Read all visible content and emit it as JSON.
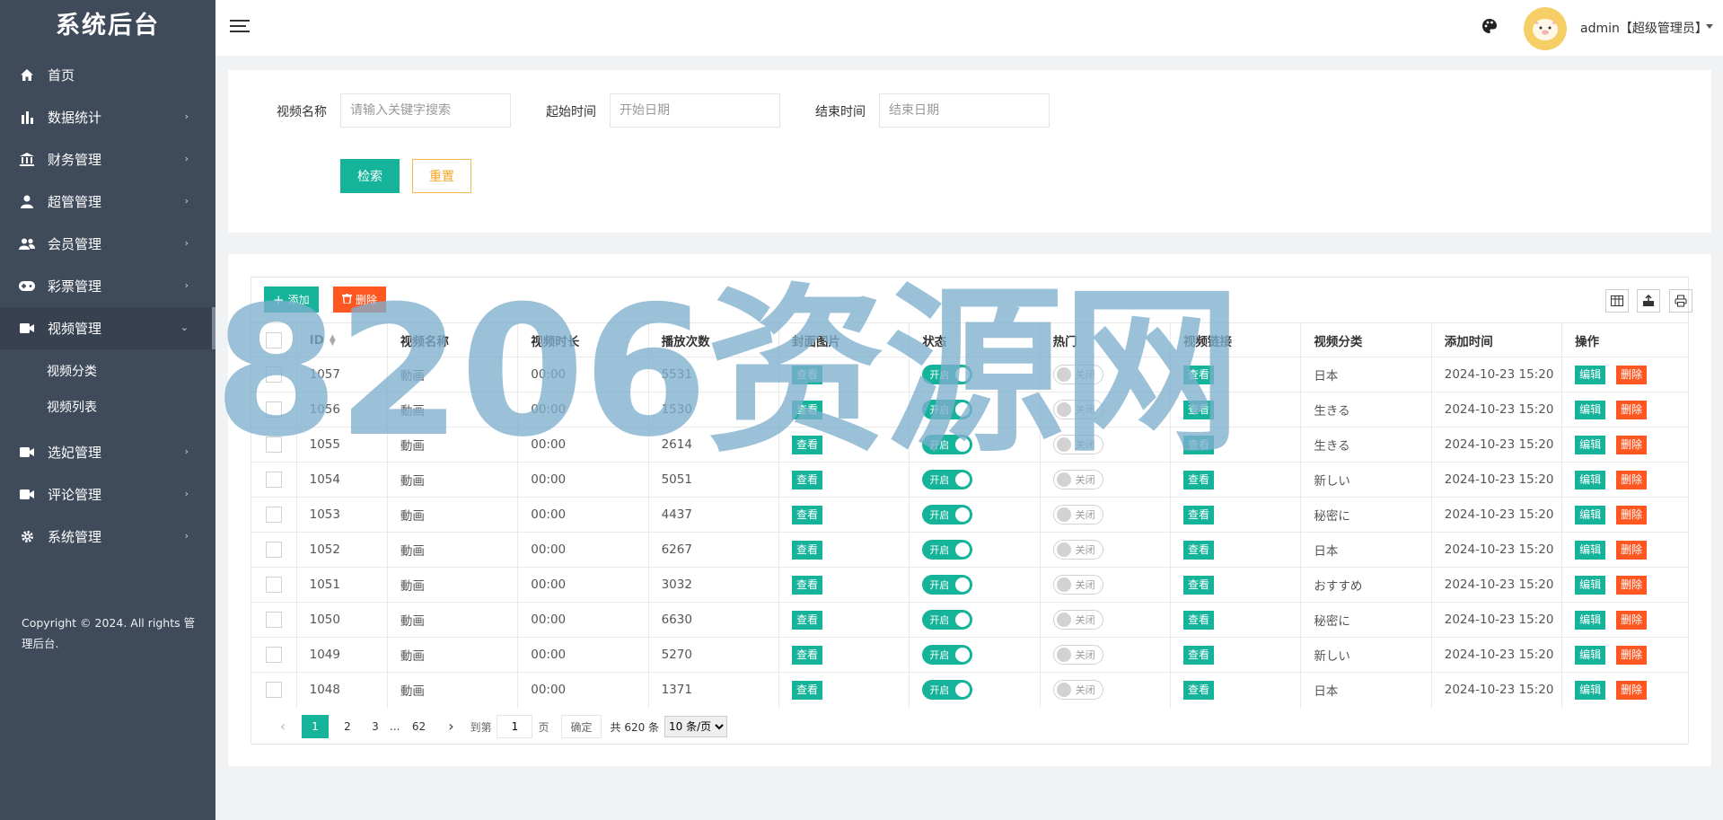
{
  "app": {
    "title": "系统后台"
  },
  "sidebar": {
    "items": [
      {
        "label": "首页",
        "icon": "home-icon",
        "chevron": false
      },
      {
        "label": "数据统计",
        "icon": "bar-chart-icon",
        "chevron": true
      },
      {
        "label": "财务管理",
        "icon": "bank-icon",
        "chevron": true
      },
      {
        "label": "超管管理",
        "icon": "user-icon",
        "chevron": true
      },
      {
        "label": "会员管理",
        "icon": "users-icon",
        "chevron": true
      },
      {
        "label": "彩票管理",
        "icon": "gamepad-icon",
        "chevron": true
      },
      {
        "label": "视频管理",
        "icon": "video-icon",
        "chevron": true,
        "active": true
      },
      {
        "label": "选妃管理",
        "icon": "video-icon",
        "chevron": true
      },
      {
        "label": "评论管理",
        "icon": "video-icon",
        "chevron": true
      },
      {
        "label": "系统管理",
        "icon": "gear-icon",
        "chevron": true
      }
    ],
    "subitems": [
      "视频分类",
      "视频列表"
    ],
    "copyright": "Copyright © 2024. All rights 管理后台."
  },
  "header": {
    "user": "admin【超级管理员】",
    "icons": [
      "menu-toggle-icon",
      "palette-icon",
      "avatar"
    ]
  },
  "search": {
    "name_label": "视频名称",
    "name_placeholder": "请输入关键字搜索",
    "start_label": "起始时间",
    "start_placeholder": "开始日期",
    "end_label": "结束时间",
    "end_placeholder": "结束日期",
    "search_button": "检索",
    "reset_button": "重置"
  },
  "toolbar": {
    "add_label": "添加",
    "delete_label": "删除",
    "icons": [
      "columns-icon",
      "export-icon",
      "print-icon"
    ]
  },
  "table": {
    "columns": [
      "ID",
      "视频名称",
      "视频时长",
      "播放次数",
      "封面图片",
      "状态",
      "热门",
      "视频链接",
      "视频分类",
      "添加时间",
      "操作"
    ],
    "rows": [
      {
        "id": "1057",
        "name": "動画",
        "duration": "00:00",
        "plays": "5531",
        "cover": "查看",
        "status": "开启",
        "hot": "关闭",
        "link": "查看",
        "category": "日本",
        "added": "2024-10-23 15:20"
      },
      {
        "id": "1056",
        "name": "動画",
        "duration": "00:00",
        "plays": "1530",
        "cover": "查看",
        "status": "开启",
        "hot": "关闭",
        "link": "查看",
        "category": "生きる",
        "added": "2024-10-23 15:20"
      },
      {
        "id": "1055",
        "name": "動画",
        "duration": "00:00",
        "plays": "2614",
        "cover": "查看",
        "status": "开启",
        "hot": "关闭",
        "link": "查看",
        "category": "生きる",
        "added": "2024-10-23 15:20"
      },
      {
        "id": "1054",
        "name": "動画",
        "duration": "00:00",
        "plays": "5051",
        "cover": "查看",
        "status": "开启",
        "hot": "关闭",
        "link": "查看",
        "category": "新しい",
        "added": "2024-10-23 15:20"
      },
      {
        "id": "1053",
        "name": "動画",
        "duration": "00:00",
        "plays": "4437",
        "cover": "查看",
        "status": "开启",
        "hot": "关闭",
        "link": "查看",
        "category": "秘密に",
        "added": "2024-10-23 15:20"
      },
      {
        "id": "1052",
        "name": "動画",
        "duration": "00:00",
        "plays": "6267",
        "cover": "查看",
        "status": "开启",
        "hot": "关闭",
        "link": "查看",
        "category": "日本",
        "added": "2024-10-23 15:20"
      },
      {
        "id": "1051",
        "name": "動画",
        "duration": "00:00",
        "plays": "3032",
        "cover": "查看",
        "status": "开启",
        "hot": "关闭",
        "link": "查看",
        "category": "おすすめ",
        "added": "2024-10-23 15:20"
      },
      {
        "id": "1050",
        "name": "動画",
        "duration": "00:00",
        "plays": "6630",
        "cover": "查看",
        "status": "开启",
        "hot": "关闭",
        "link": "查看",
        "category": "秘密に",
        "added": "2024-10-23 15:20"
      },
      {
        "id": "1049",
        "name": "動画",
        "duration": "00:00",
        "plays": "5270",
        "cover": "查看",
        "status": "开启",
        "hot": "关闭",
        "link": "查看",
        "category": "新しい",
        "added": "2024-10-23 15:20"
      },
      {
        "id": "1048",
        "name": "動画",
        "duration": "00:00",
        "plays": "1371",
        "cover": "查看",
        "status": "开启",
        "hot": "关闭",
        "link": "查看",
        "category": "日本",
        "added": "2024-10-23 15:20"
      }
    ],
    "edit_label": "编辑",
    "delete_label": "删除"
  },
  "pagination": {
    "pages": [
      "1",
      "2",
      "3",
      "...",
      "62"
    ],
    "current": "1",
    "goto_label": "到第",
    "page_value": "1",
    "page_unit": "页",
    "ok_label": "确定",
    "total": "共 620 条",
    "per_page": "10 条/页"
  },
  "watermark": "8206资源网",
  "colors": {
    "sidebar": "#3f4a5a",
    "accent": "#16b39b",
    "danger": "#ff5722",
    "warning": "#f5a623"
  }
}
